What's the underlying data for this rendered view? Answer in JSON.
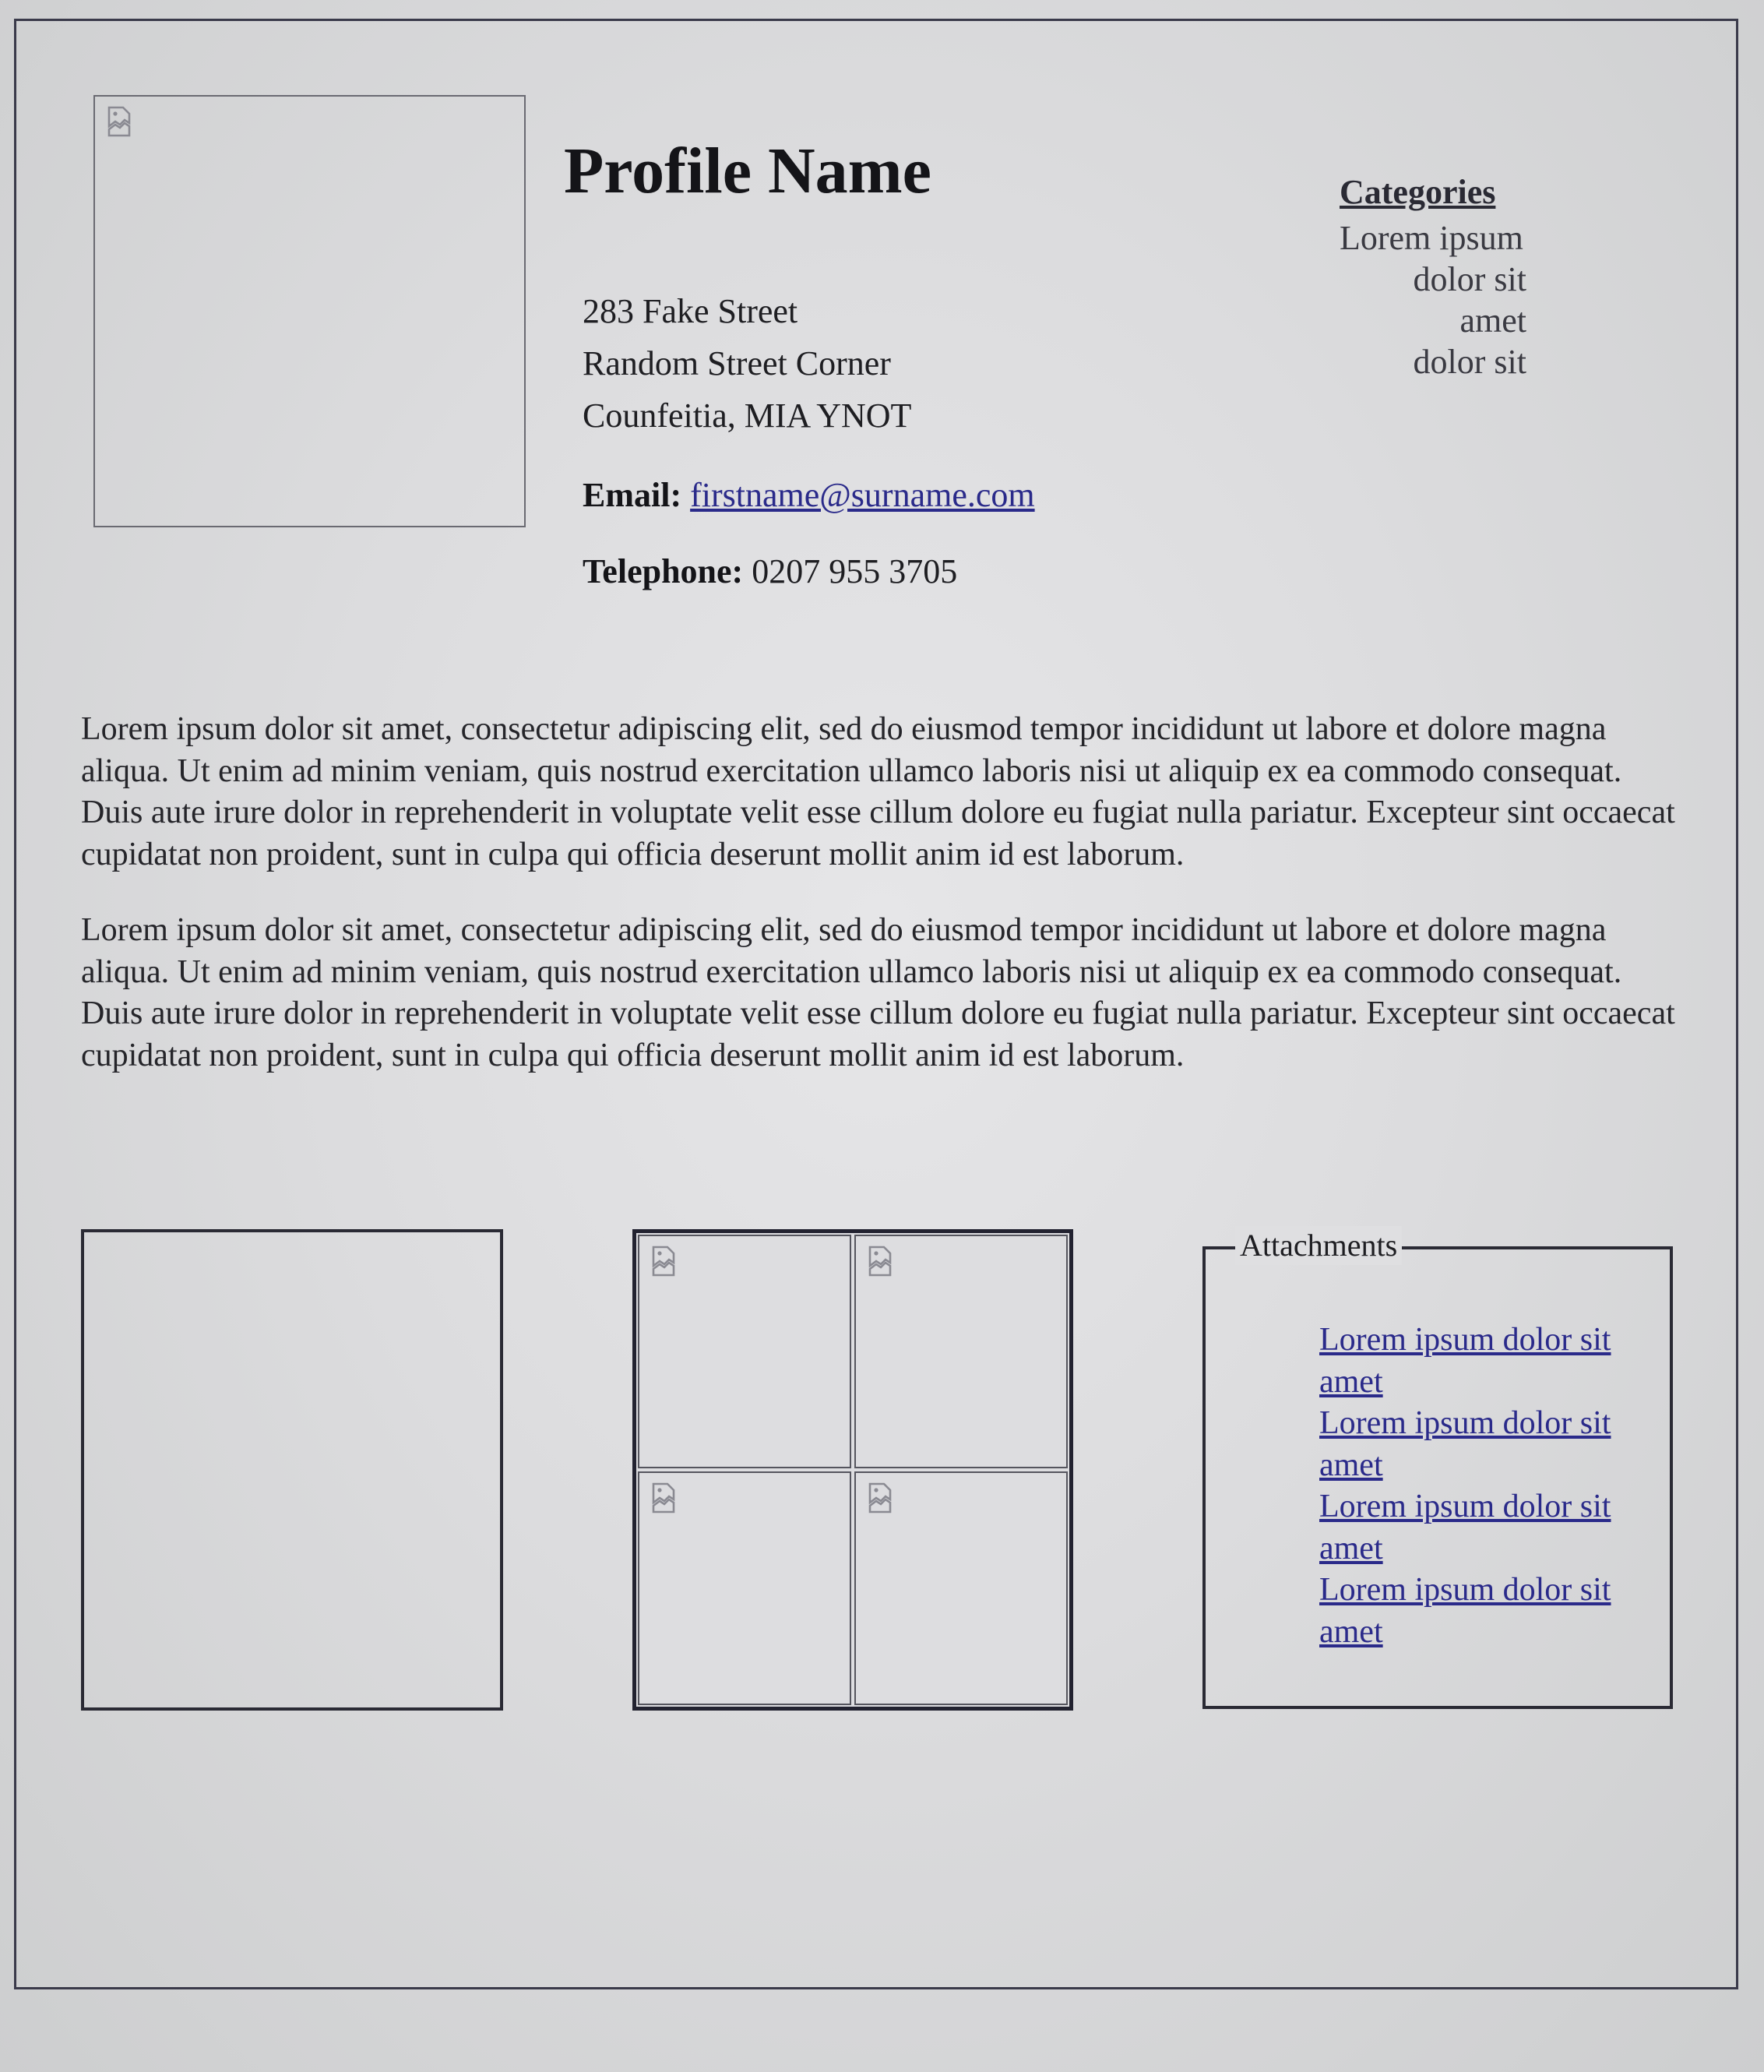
{
  "profile": {
    "name": "Profile Name",
    "address": {
      "line1": "283 Fake Street",
      "line2": "Random Street Corner",
      "line3": "Counfeitia, MIA YNOT"
    },
    "email_label": "Email:",
    "email": "firstname@surname.com",
    "telephone_label": "Telephone:",
    "telephone": "0207 955 3705"
  },
  "categories": {
    "heading": "Categories",
    "items": [
      "Lorem ipsum",
      "dolor sit",
      "amet",
      "dolor sit"
    ]
  },
  "body": {
    "paragraphs": [
      "Lorem ipsum dolor sit amet, consectetur adipiscing elit, sed do eiusmod tempor incididunt ut labore et dolore magna aliqua. Ut enim ad minim veniam, quis nostrud exercitation ullamco laboris nisi ut aliquip ex ea commodo consequat. Duis aute irure dolor in reprehenderit in voluptate velit esse cillum dolore eu fugiat nulla pariatur. Excepteur sint occaecat cupidatat non proident, sunt in culpa qui officia deserunt mollit anim id est laborum.",
      "Lorem ipsum dolor sit amet, consectetur adipiscing elit, sed do eiusmod tempor incididunt ut labore et dolore magna aliqua. Ut enim ad minim veniam, quis nostrud exercitation ullamco laboris nisi ut aliquip ex ea commodo consequat. Duis aute irure dolor in reprehenderit in voluptate velit esse cillum dolore eu fugiat nulla pariatur. Excepteur sint occaecat cupidatat non proident, sunt in culpa qui officia deserunt mollit anim id est laborum."
    ]
  },
  "attachments": {
    "legend": "Attachments",
    "links": [
      "Lorem ipsum dolor sit amet",
      "Lorem ipsum dolor sit amet",
      "Lorem ipsum dolor sit amet",
      "Lorem ipsum dolor sit amet"
    ]
  },
  "icons": {
    "image_placeholder": "broken-image-icon"
  },
  "colors": {
    "link": "#2a2a8a",
    "border": "#2a2a34",
    "background": "#dcdcde"
  }
}
